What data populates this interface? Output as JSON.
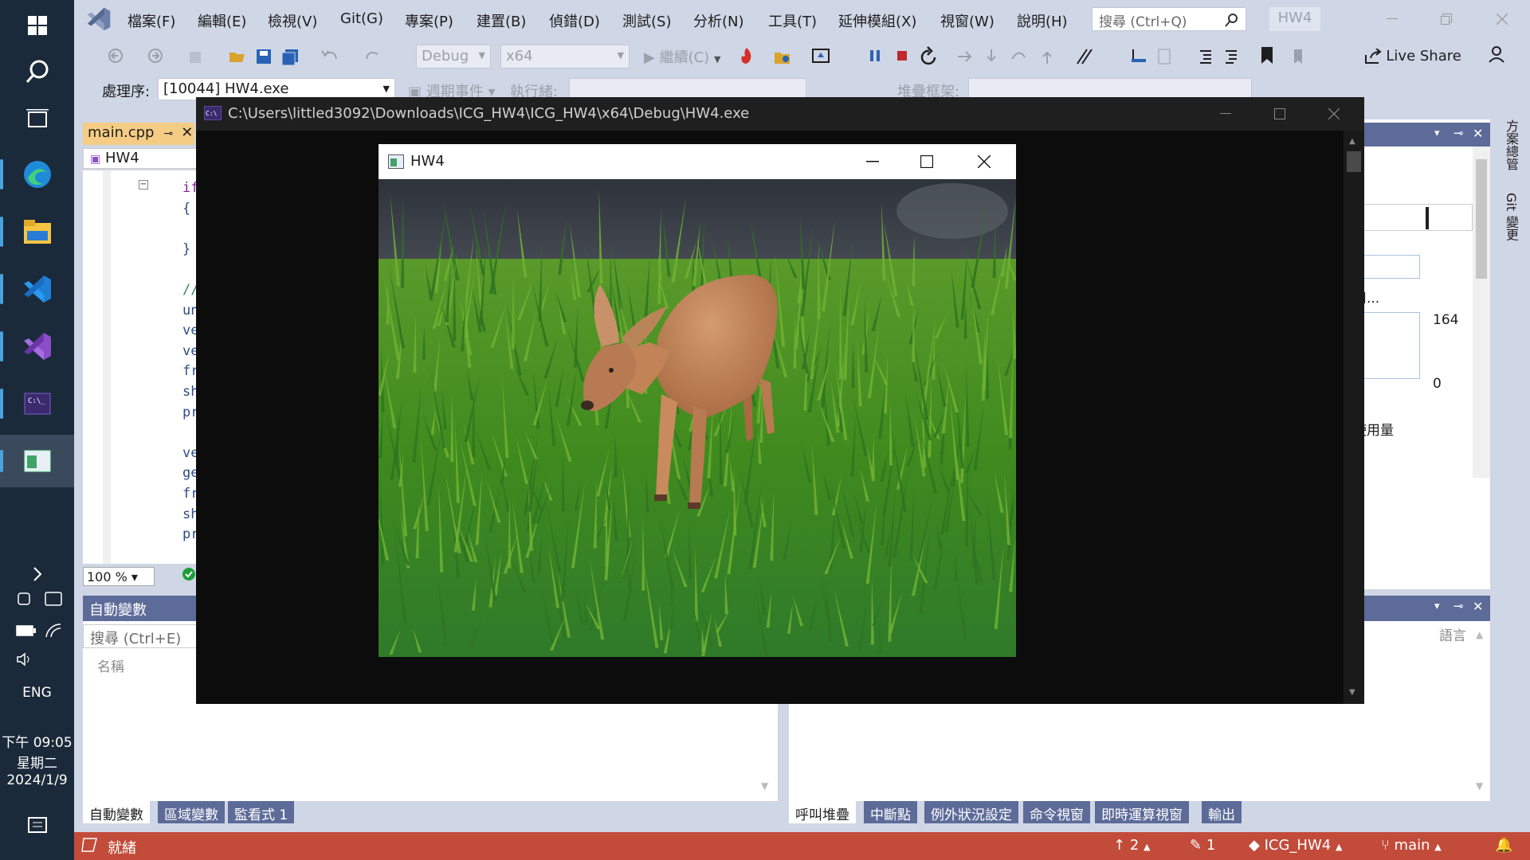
{
  "taskbar": {
    "lang": "ENG",
    "time": "下午 09:05",
    "weekday": "星期二",
    "date": "2024/1/9",
    "apps": [
      "edge-icon",
      "file-explorer-icon",
      "vscode-icon",
      "visual-studio-icon",
      "terminal-icon",
      "opengl-app-icon"
    ]
  },
  "menu": {
    "items": [
      "檔案(F)",
      "編輯(E)",
      "檢視(V)",
      "Git(G)",
      "專案(P)",
      "建置(B)",
      "偵錯(D)",
      "測試(S)",
      "分析(N)",
      "工具(T)",
      "延伸模組(X)",
      "視窗(W)",
      "說明(H)"
    ],
    "search_placeholder": "搜尋 (Ctrl+Q)",
    "project_title": "HW4"
  },
  "toolbar": {
    "config": "Debug",
    "platform": "x64",
    "continue_label": "繼續(C)",
    "live_share": "Live Share",
    "process_label": "處理序:",
    "process_value": "[10044] HW4.exe",
    "lifecycle_label": "週期事件",
    "thread_label": "執行緒:",
    "stackframe_label": "堆疊框架:"
  },
  "editor": {
    "tab": "main.cpp",
    "nav": "HW4",
    "lines": [
      "if",
      "{",
      "",
      "}",
      "",
      "//",
      "un",
      "ve",
      "ve",
      "fr",
      "sh",
      "pr",
      "",
      "ve",
      "ge",
      "fr",
      "sh",
      "pr"
    ],
    "zoom": "100 %"
  },
  "autos": {
    "title": "自動變數",
    "search": "搜尋 (Ctrl+E)",
    "col_name": "名稱",
    "tabs": [
      "自動變數",
      "區域變數",
      "監看式 1"
    ]
  },
  "callstack": {
    "col_lang": "語言",
    "tabs": [
      "呼叫堆疊",
      "中斷點",
      "例外狀況設定",
      "命令視窗",
      "即時運算視窗",
      "輸出"
    ]
  },
  "diag": {
    "val_top": "164",
    "val_bottom": "0",
    "label_use": "用...",
    "label_usage": "使用量"
  },
  "side_tabs": [
    "方案總管",
    "Git 變更"
  ],
  "status": {
    "ready": "就緒",
    "up_count": "2",
    "edit_count": "1",
    "repo": "ICG_HW4",
    "branch": "main"
  },
  "console": {
    "title": "C:\\Users\\littled3092\\Downloads\\ICG_HW4\\ICG_HW4\\x64\\Debug\\HW4.exe"
  },
  "glwin": {
    "title": "HW4"
  },
  "colors": {
    "vs_bg": "#cfd6e5",
    "accent": "#5d6b99",
    "status": "#c24b3a",
    "grass": "#3f8a1e",
    "sky": "#3c4149",
    "deer": "#c98a5e"
  }
}
